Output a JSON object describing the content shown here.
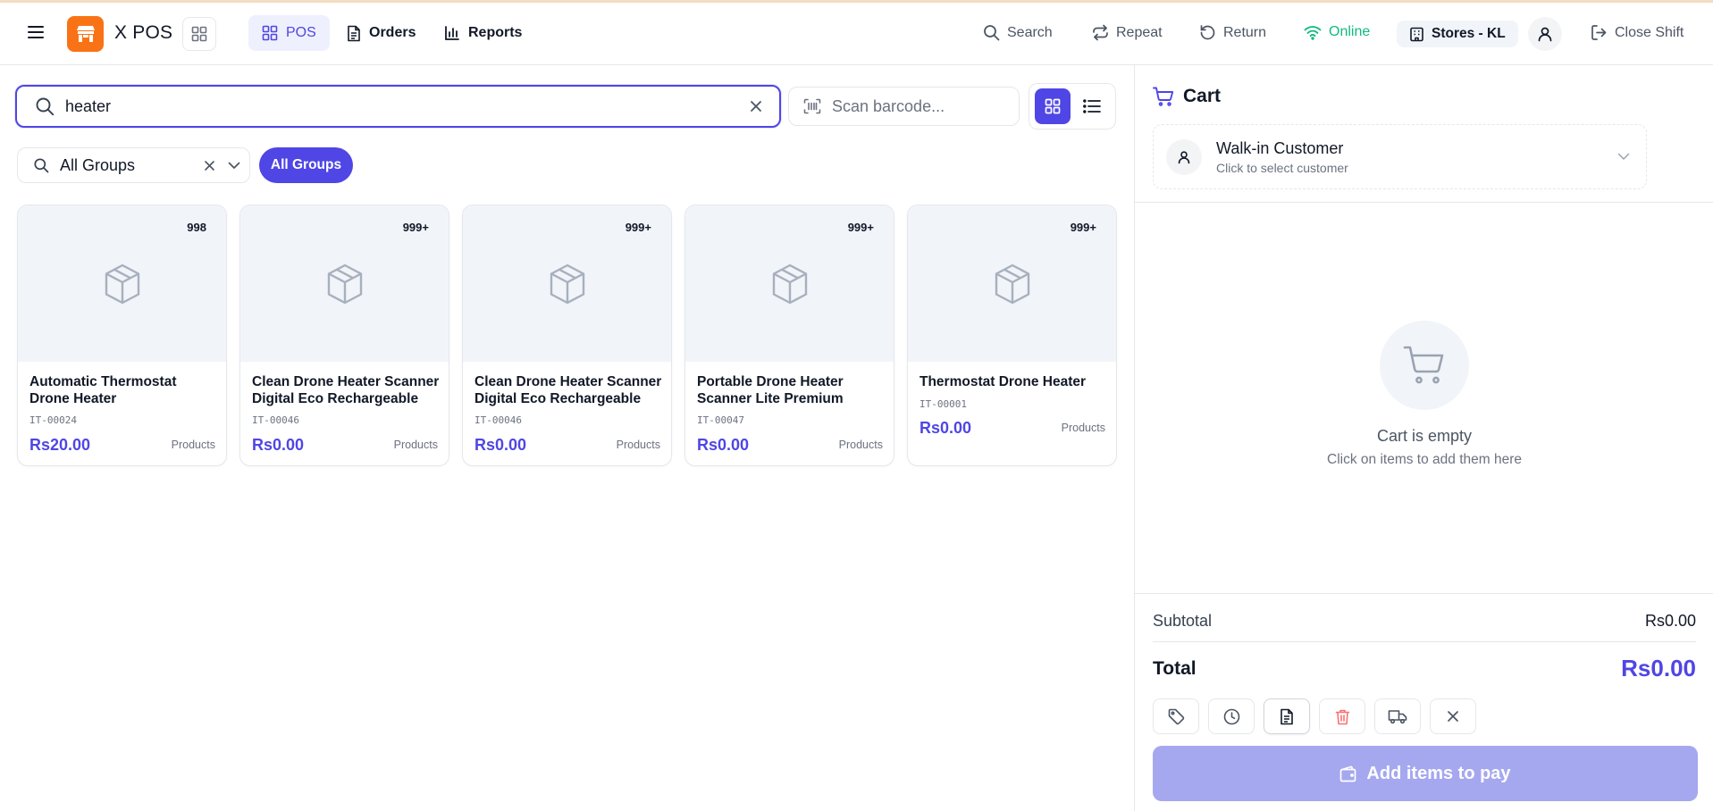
{
  "app": {
    "title": "X POS"
  },
  "nav": [
    {
      "label": "POS",
      "icon": "grid-icon",
      "active": true
    },
    {
      "label": "Orders",
      "icon": "document-icon",
      "active": false
    },
    {
      "label": "Reports",
      "icon": "bar-chart-icon",
      "active": false
    }
  ],
  "topbar": {
    "search": "Search",
    "repeat": "Repeat",
    "return": "Return",
    "status": "Online",
    "store": "Stores - KL",
    "close_shift": "Close Shift"
  },
  "search": {
    "value": "heater"
  },
  "barcode": {
    "placeholder": "Scan barcode..."
  },
  "group_filter": {
    "value": "All Groups",
    "chip": "All Groups"
  },
  "products": [
    {
      "name": "Automatic Thermostat Drone Heater",
      "code": "IT-00024",
      "price": "Rs20.00",
      "category": "Products",
      "stock": "998"
    },
    {
      "name": "Clean Drone Heater Scanner Digital Eco Rechargeable",
      "code": "IT-00046",
      "price": "Rs0.00",
      "category": "Products",
      "stock": "999+"
    },
    {
      "name": "Clean Drone Heater Scanner Digital Eco Rechargeable",
      "code": "IT-00046",
      "price": "Rs0.00",
      "category": "Products",
      "stock": "999+"
    },
    {
      "name": "Portable Drone Heater Scanner Lite Premium",
      "code": "IT-00047",
      "price": "Rs0.00",
      "category": "Products",
      "stock": "999+"
    },
    {
      "name": "Thermostat Drone Heater",
      "code": "IT-00001",
      "price": "Rs0.00",
      "category": "Products",
      "stock": "999+"
    }
  ],
  "cart": {
    "title": "Cart",
    "customer": {
      "name": "Walk-in Customer",
      "hint": "Click to select customer"
    },
    "empty_title": "Cart is empty",
    "empty_hint": "Click on items to add them here",
    "subtotal_label": "Subtotal",
    "subtotal_value": "Rs0.00",
    "total_label": "Total",
    "total_value": "Rs0.00",
    "pay_button": "Add items to pay"
  },
  "colors": {
    "accent": "#4f46e5",
    "brand": "#f97316",
    "online": "#10b981",
    "pay_disabled": "#a5a8ef"
  }
}
